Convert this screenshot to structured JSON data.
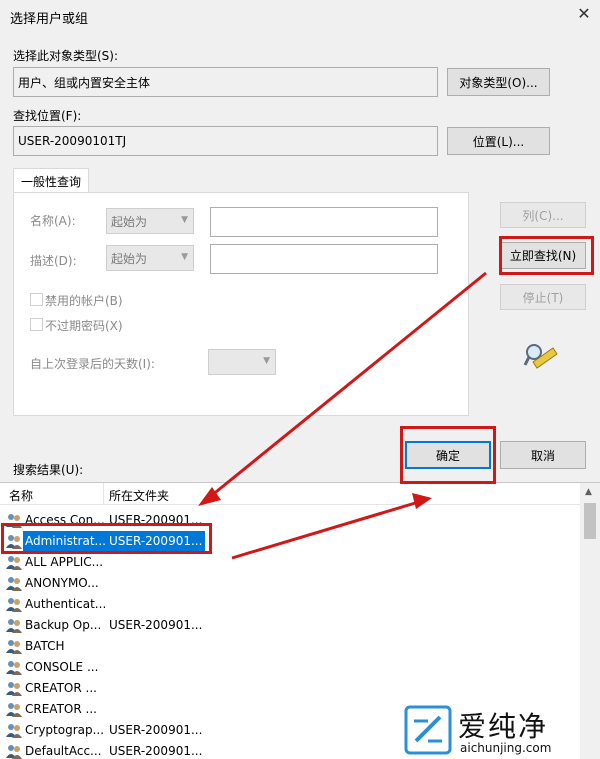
{
  "window": {
    "title": "选择用户或组",
    "close_glyph": "✕"
  },
  "object_type": {
    "label": "选择此对象类型(S):",
    "value": "用户、组或内置安全主体",
    "button": "对象类型(O)..."
  },
  "location": {
    "label": "查找位置(F):",
    "value": "USER-20090101TJ",
    "button": "位置(L)..."
  },
  "query": {
    "tab": "一般性查询",
    "name_label": "名称(A):",
    "name_mode": "起始为",
    "desc_label": "描述(D):",
    "desc_mode": "起始为",
    "disabled_accounts": "禁用的帐户(B)",
    "non_expiring_pw": "不过期密码(X)",
    "days_since_logon": "自上次登录后的天数(I):"
  },
  "side_buttons": {
    "columns": "列(C)...",
    "find_now": "立即查找(N)",
    "stop": "停止(T)"
  },
  "ok_label": "确定",
  "cancel_label": "取消",
  "results": {
    "label": "搜索结果(U):",
    "col_name": "名称",
    "col_folder": "所在文件夹",
    "rows": [
      {
        "name": "Access Con...",
        "folder": "USER-200901..."
      },
      {
        "name": "Administrat...",
        "folder": "USER-200901...",
        "selected": true
      },
      {
        "name": "ALL APPLIC...",
        "folder": ""
      },
      {
        "name": "ANONYMO...",
        "folder": ""
      },
      {
        "name": "Authenticat...",
        "folder": ""
      },
      {
        "name": "Backup Op...",
        "folder": "USER-200901..."
      },
      {
        "name": "BATCH",
        "folder": ""
      },
      {
        "name": "CONSOLE ...",
        "folder": ""
      },
      {
        "name": "CREATOR ...",
        "folder": ""
      },
      {
        "name": "CREATOR ...",
        "folder": ""
      },
      {
        "name": "Cryptograp...",
        "folder": "USER-200901..."
      },
      {
        "name": "DefaultAcc...",
        "folder": "USER-200901..."
      }
    ]
  },
  "watermark": {
    "brand": "爱纯净",
    "url": "aichunjing.com"
  },
  "colors": {
    "accent": "#0078d7",
    "annotation": "#d01818"
  }
}
